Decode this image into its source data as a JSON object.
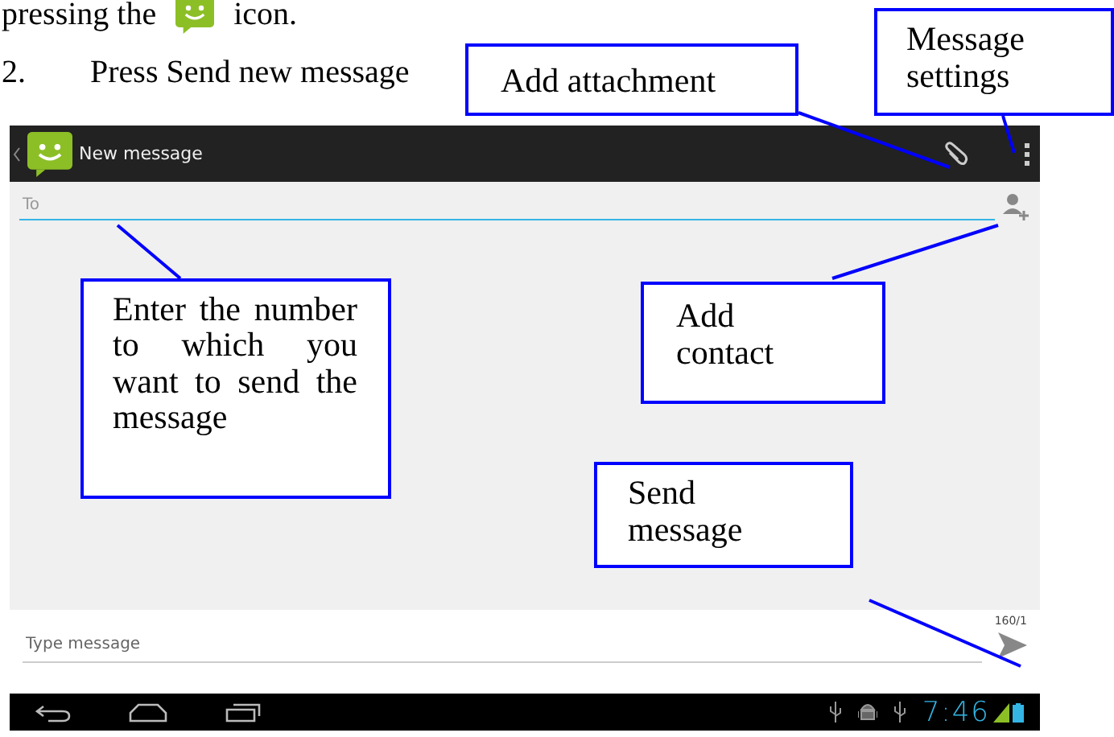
{
  "manual_text": {
    "line_1": {
      "before_icon": "pressing the",
      "after_icon": "icon."
    },
    "line_2": {
      "number": "2.",
      "text": "Press Send new message"
    }
  },
  "screenshot": {
    "app_bar": {
      "title": "New message"
    },
    "to_field": {
      "placeholder": "To"
    },
    "counter": "160/1",
    "message_field": {
      "placeholder": "Type message"
    },
    "status_bar": {
      "time": "7:46"
    }
  },
  "callouts": [
    {
      "kind": "attachment",
      "text": "Add attachment"
    },
    {
      "kind": "settings",
      "text": "Message settings"
    },
    {
      "kind": "recipient",
      "text": "Enter the number to which you want to send the message"
    },
    {
      "kind": "contact",
      "text": "Add contact"
    },
    {
      "kind": "send",
      "text": "Send message"
    }
  ]
}
